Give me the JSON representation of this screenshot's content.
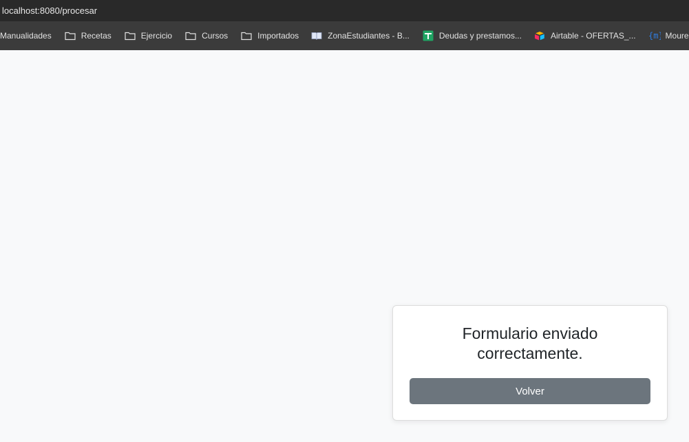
{
  "browser": {
    "url": "localhost:8080/procesar",
    "bookmarks": [
      {
        "label": "Manualidades",
        "icon": "none"
      },
      {
        "label": "Recetas",
        "icon": "folder-icon"
      },
      {
        "label": "Ejercicio",
        "icon": "folder-icon"
      },
      {
        "label": "Cursos",
        "icon": "folder-icon"
      },
      {
        "label": "Importados",
        "icon": "folder-icon"
      },
      {
        "label": "ZonaEstudiantes - B...",
        "icon": "book-icon"
      },
      {
        "label": "Deudas y prestamos...",
        "icon": "sheets-icon"
      },
      {
        "label": "Airtable - OFERTAS_...",
        "icon": "airtable-icon"
      },
      {
        "label": "MoureDev | Te",
        "icon": "mouredev-icon"
      }
    ]
  },
  "card": {
    "title": "Formulario enviado correctamente.",
    "button_label": "Volver"
  },
  "colors": {
    "page_bg": "#f8f9fa",
    "button_bg": "#6c757d",
    "sheets_green": "#1fa463"
  }
}
